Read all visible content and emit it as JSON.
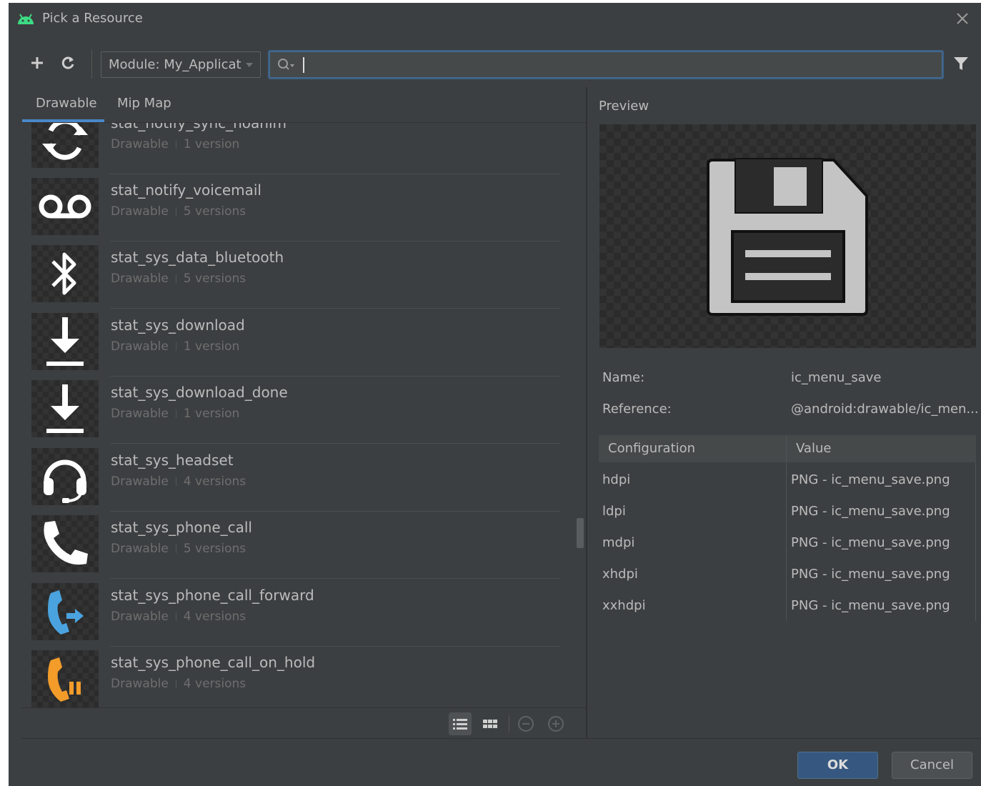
{
  "window": {
    "title": "Pick a Resource",
    "icon": "android-icon"
  },
  "toolbar": {
    "add_icon": "plus-icon",
    "refresh_icon": "refresh-icon",
    "module_label": "Module: My_Applicat",
    "search_value": "",
    "filter_icon": "filter-icon"
  },
  "tabs": [
    {
      "label": "Drawable",
      "active": true
    },
    {
      "label": "Mip Map",
      "active": false
    }
  ],
  "resources": [
    {
      "name": "stat_notify_sync_noanim",
      "type": "Drawable",
      "versions": "1 version",
      "icon": "sync-icon"
    },
    {
      "name": "stat_notify_voicemail",
      "type": "Drawable",
      "versions": "5 versions",
      "icon": "voicemail-icon"
    },
    {
      "name": "stat_sys_data_bluetooth",
      "type": "Drawable",
      "versions": "5 versions",
      "icon": "bluetooth-icon"
    },
    {
      "name": "stat_sys_download",
      "type": "Drawable",
      "versions": "1 version",
      "icon": "download-icon"
    },
    {
      "name": "stat_sys_download_done",
      "type": "Drawable",
      "versions": "1 version",
      "icon": "download-done-icon"
    },
    {
      "name": "stat_sys_headset",
      "type": "Drawable",
      "versions": "4 versions",
      "icon": "headset-icon"
    },
    {
      "name": "stat_sys_phone_call",
      "type": "Drawable",
      "versions": "5 versions",
      "icon": "phone-icon"
    },
    {
      "name": "stat_sys_phone_call_forward",
      "type": "Drawable",
      "versions": "4 versions",
      "icon": "phone-forward-icon"
    },
    {
      "name": "stat_sys_phone_call_on_hold",
      "type": "Drawable",
      "versions": "4 versions",
      "icon": "phone-hold-icon"
    }
  ],
  "bottom_bar": {
    "list_view_icon": "list-view-icon",
    "grid_view_icon": "grid-view-icon",
    "zoom_out_icon": "zoom-out-icon",
    "zoom_in_icon": "zoom-in-icon"
  },
  "preview": {
    "label": "Preview",
    "image_icon": "floppy-save-icon",
    "name_label": "Name:",
    "name_value": "ic_menu_save",
    "reference_label": "Reference:",
    "reference_value": "@android:drawable/ic_men..."
  },
  "config_table": {
    "headers": [
      "Configuration",
      "Value"
    ],
    "rows": [
      {
        "config": "hdpi",
        "value": "PNG - ic_menu_save.png"
      },
      {
        "config": "ldpi",
        "value": "PNG - ic_menu_save.png"
      },
      {
        "config": "mdpi",
        "value": "PNG - ic_menu_save.png"
      },
      {
        "config": "xhdpi",
        "value": "PNG - ic_menu_save.png"
      },
      {
        "config": "xxhdpi",
        "value": "PNG - ic_menu_save.png"
      }
    ]
  },
  "footer": {
    "ok_label": "OK",
    "cancel_label": "Cancel"
  },
  "colors": {
    "background": "#3c3f41",
    "accent": "#4a88c7",
    "ok_button": "#365880",
    "phone_forward": "#4aa3df",
    "phone_hold": "#f39c2a"
  }
}
